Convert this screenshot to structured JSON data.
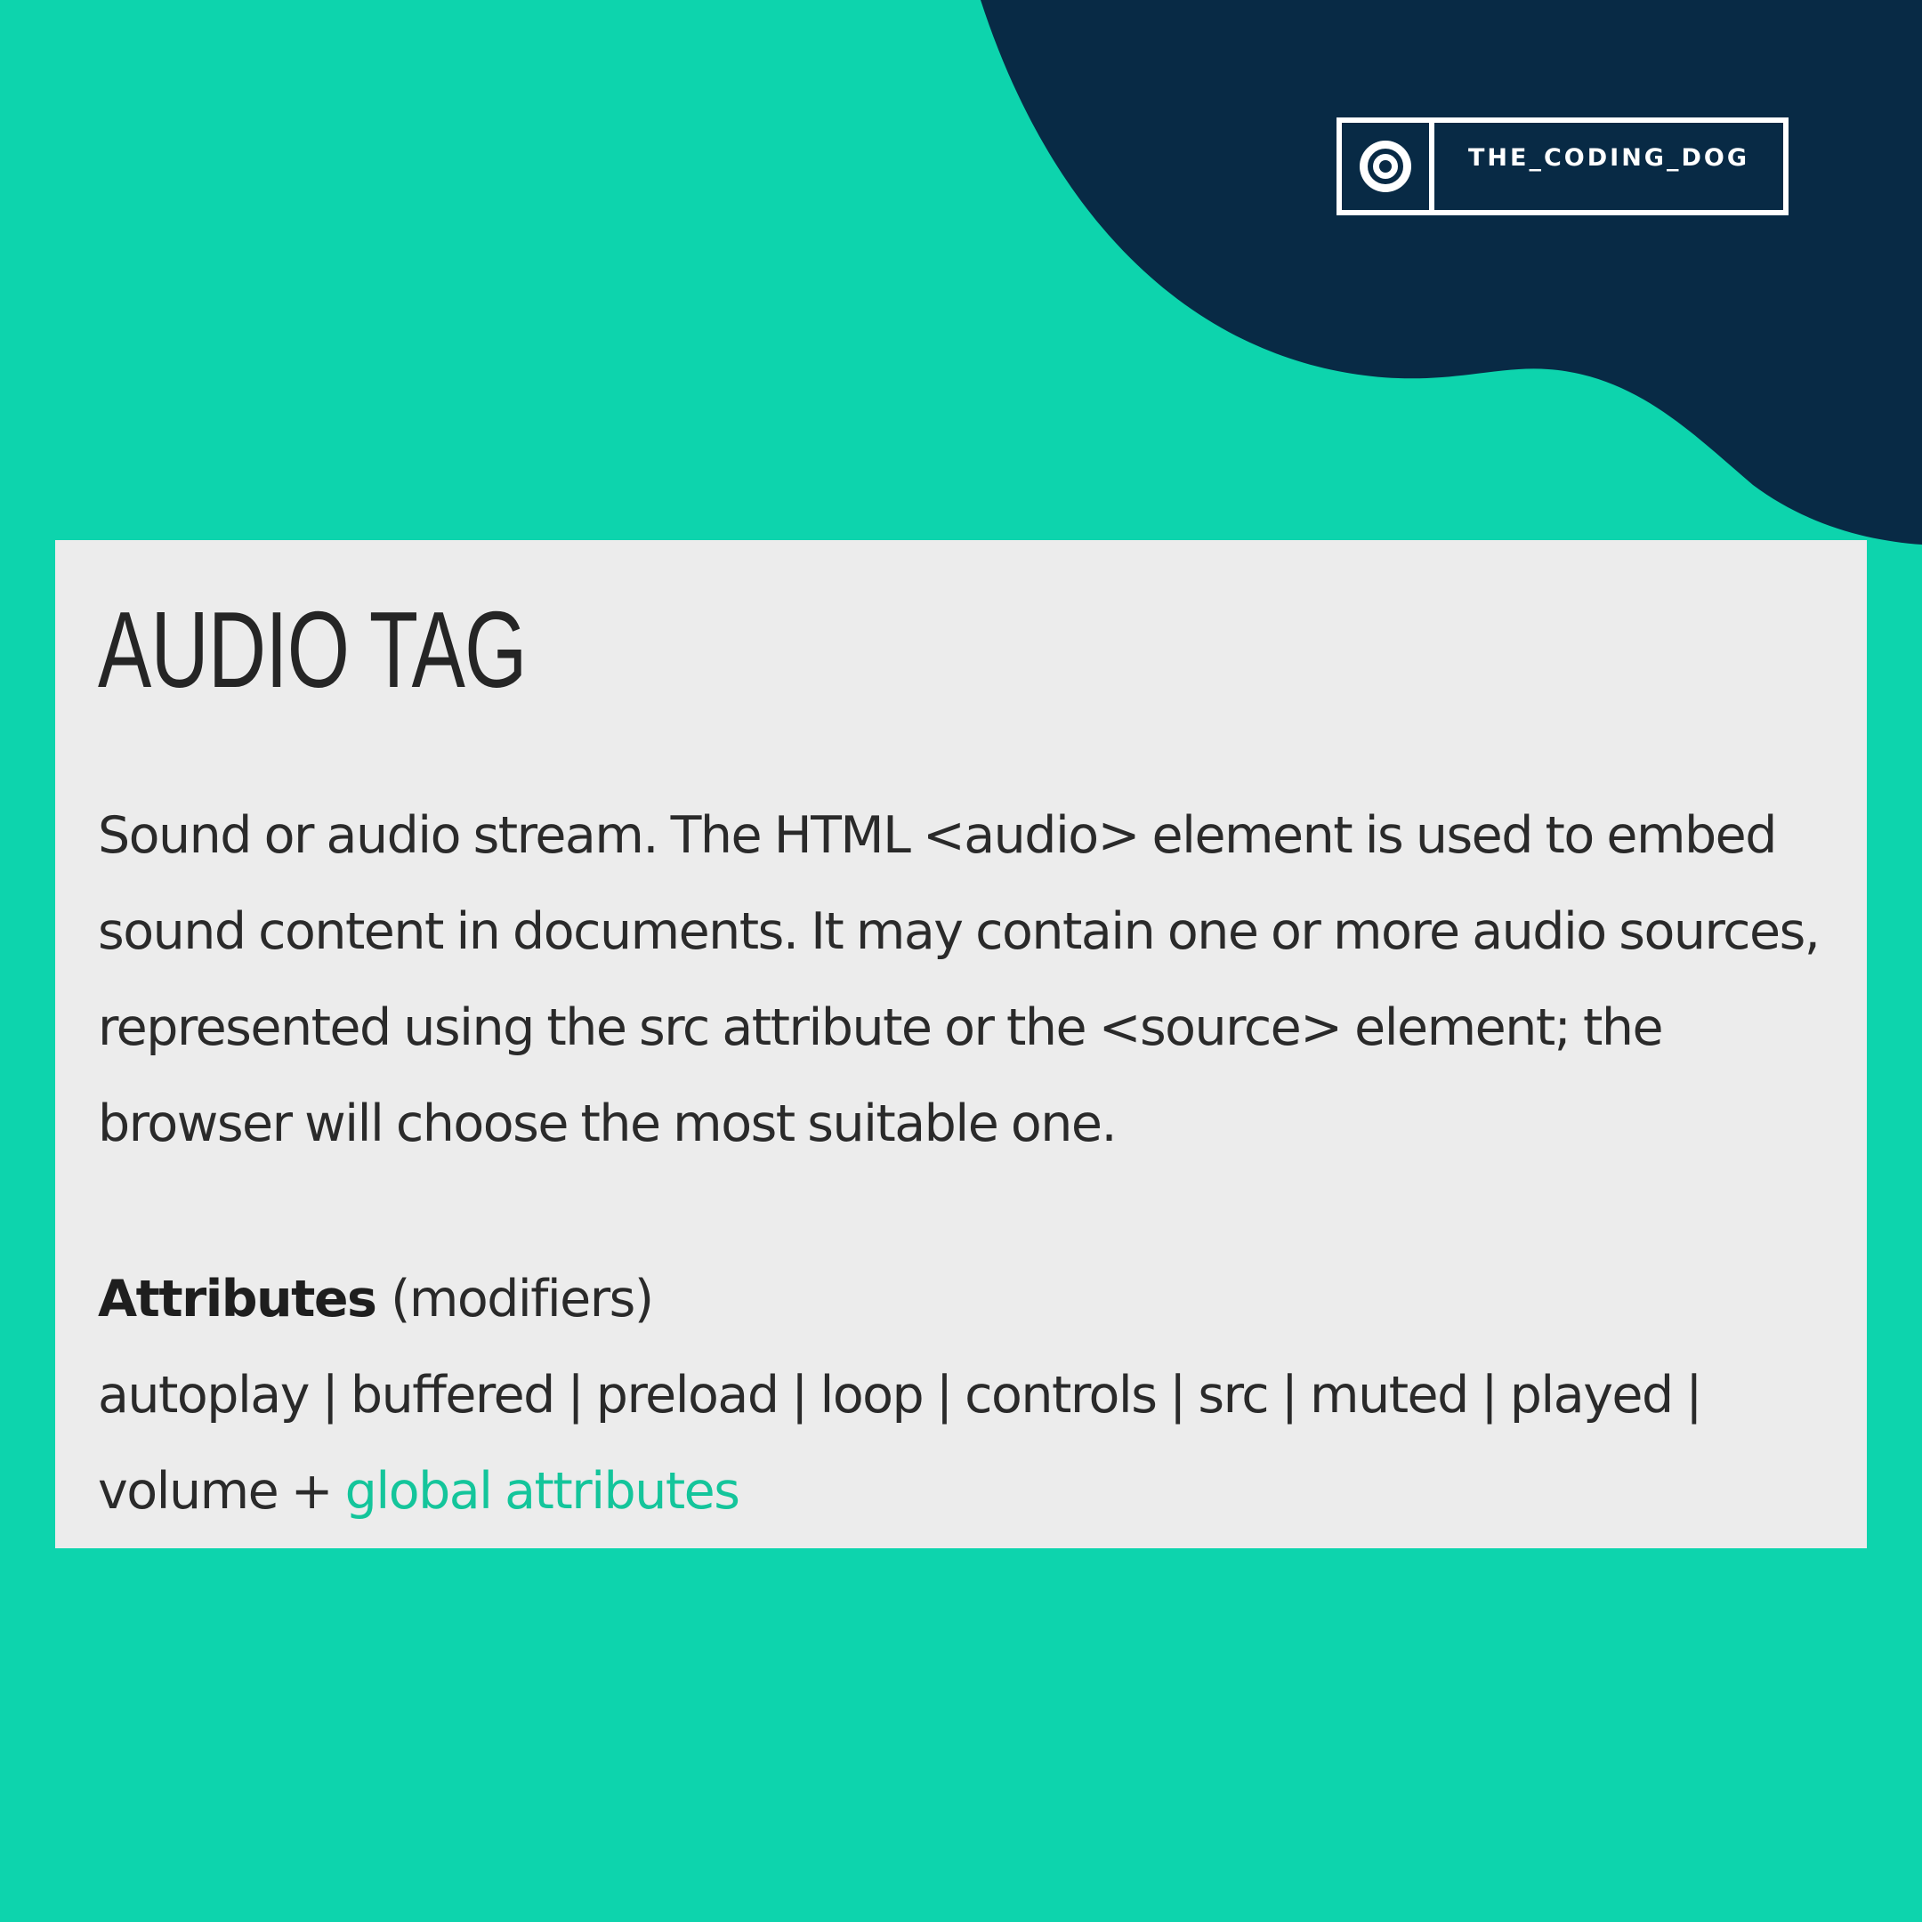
{
  "colors": {
    "background": "#0dd4ad",
    "blob": "#082a45",
    "card": "#ececec",
    "text": "#2a2a2a",
    "link": "#14c59b",
    "brand_text": "#ffffff"
  },
  "brand": {
    "icon": "target-icon",
    "name": "THE_CODING_DOG"
  },
  "card": {
    "title": "AUDIO TAG",
    "description": "Sound or audio stream. The HTML <audio> element is used to embed sound content in documents. It may contain one or more audio sources, represented using the src attribute or the <source> element; the browser will choose the most suitable one.",
    "attributes_heading_bold": "Attributes",
    "attributes_heading_rest": " (modifiers)",
    "attributes_list": "autoplay | buffered | preload | loop | controls | src | muted | played | volume + ",
    "global_link_text": "global attributes"
  }
}
